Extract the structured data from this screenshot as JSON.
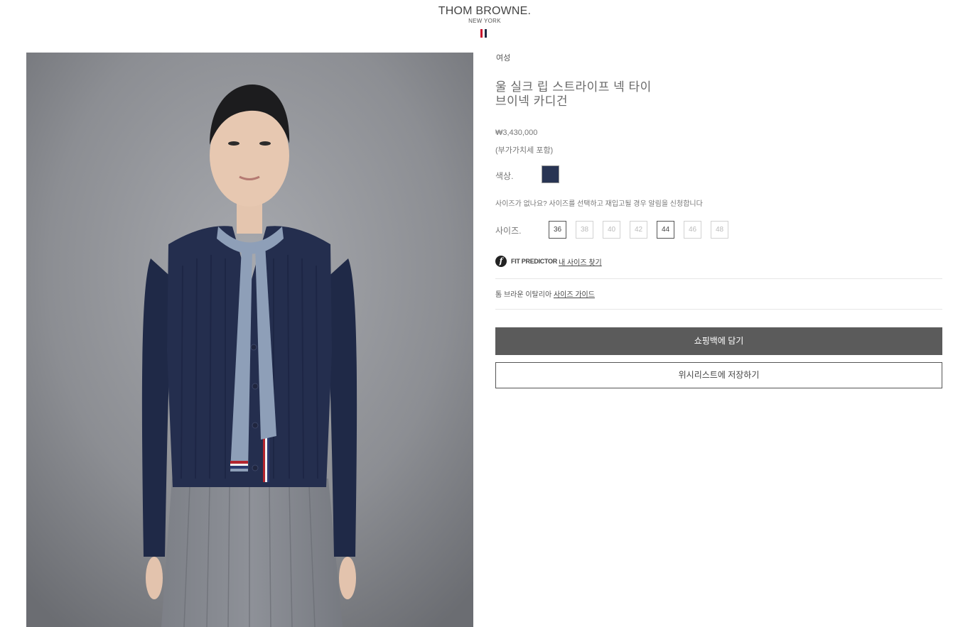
{
  "header": {
    "logo_main": "THOM BROWNE.",
    "logo_sub": "NEW YORK",
    "flag_colors": [
      "#c8102e",
      "#ffffff",
      "#1f2a44"
    ]
  },
  "product": {
    "category": "여성",
    "title_line1": "울 실크 립 스트라이프 넥 타이",
    "title_line2": "브이넥 카디건",
    "price": "₩3,430,000",
    "vat_note": "(부가가치세 포함)",
    "image_alt": "Navy rib-knit V-neck cardigan with grey neck tie, worn with grey pleated skirt"
  },
  "color": {
    "label": "색상.",
    "selected": "#283453"
  },
  "size_notice": "사이즈가 없나요? 사이즈를 선택하고 재입고될 경우 알림을 신청합니다",
  "sizes": {
    "label": "사이즈.",
    "options": [
      {
        "value": "36",
        "available": true
      },
      {
        "value": "38",
        "available": false
      },
      {
        "value": "40",
        "available": false
      },
      {
        "value": "42",
        "available": false
      },
      {
        "value": "44",
        "available": true
      },
      {
        "value": "46",
        "available": false
      },
      {
        "value": "48",
        "available": false
      }
    ]
  },
  "fit_predictor": {
    "icon": "f",
    "label": "FIT PREDICTOR",
    "link": "내 사이즈 찾기"
  },
  "size_guide": {
    "prefix": "톰 브라운 이탈리아",
    "link": "사이즈 가이드"
  },
  "actions": {
    "add_to_bag": "쇼핑백에 담기",
    "wishlist": "위시리스트에 저장하기"
  },
  "colors": {
    "button_dark": "#5b5b5b",
    "navy": "#283453",
    "text_muted": "#777777"
  }
}
